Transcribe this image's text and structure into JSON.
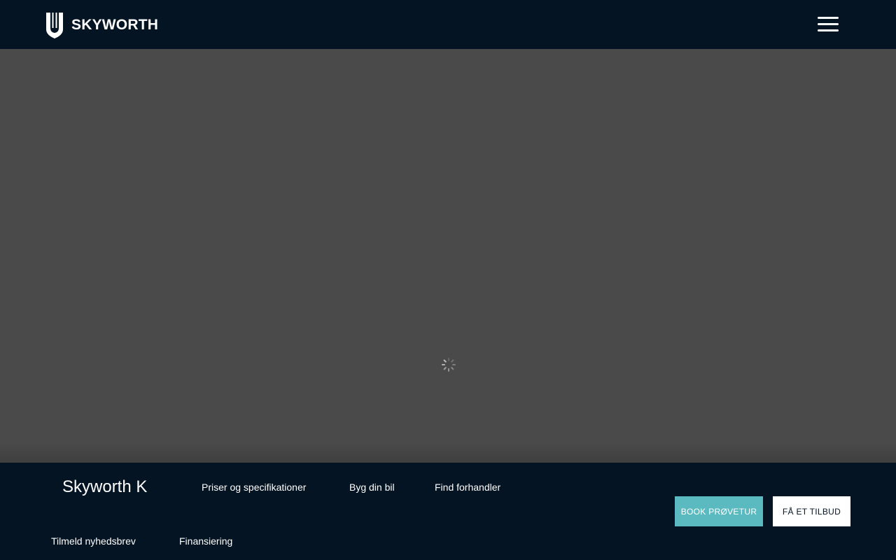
{
  "header": {
    "logo_text": "SKYWORTH",
    "menu_icon": "hamburger-menu-icon"
  },
  "main": {
    "loading_icon": "loading-spinner-icon"
  },
  "bottom_bar": {
    "model_name": "Skyworth K",
    "links": [
      "Priser og specifikationer",
      "Byg din bil",
      "Find forhandler",
      "Tilmeld nyhedsbrev",
      "Finansiering"
    ],
    "book_button": "BOOK PRØVETUR",
    "offer_button": "FÅ ET TILBUD"
  },
  "colors": {
    "header_bg": "#051423",
    "main_bg": "#4a4a4a",
    "accent": "#5abac0",
    "text": "#ffffff"
  }
}
